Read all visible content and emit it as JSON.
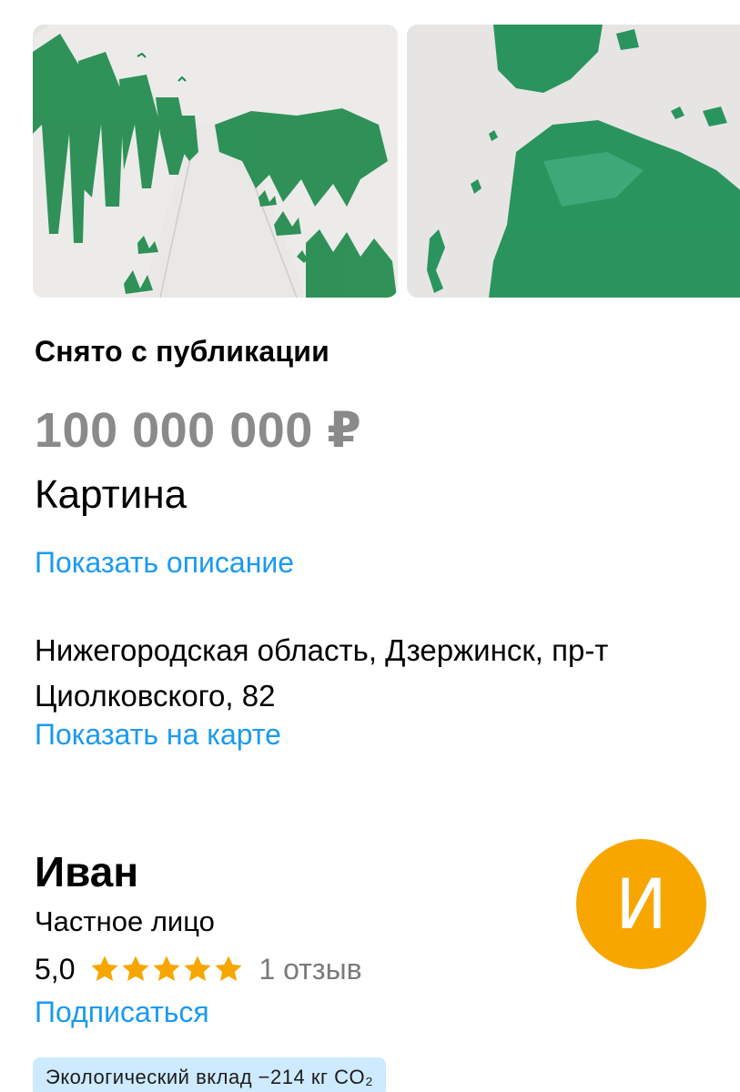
{
  "listing": {
    "status": "Снято с публикации",
    "price": "100 000 000 ₽",
    "title": "Картина",
    "show_description_link": "Показать описание",
    "address": "Нижегородская область, Дзержинск, пр-т Циолковского, 82",
    "show_on_map_link": "Показать на карте"
  },
  "seller": {
    "name": "Иван",
    "type": "Частное лицо",
    "rating": "5,0",
    "stars": 5,
    "reviews": "1 отзыв",
    "subscribe_link": "Подписаться",
    "avatar_letter": "И"
  },
  "eco_badge": "Экологический вклад −214 кг CO₂",
  "colors": {
    "link": "#1a9af0",
    "price": "#8a8a8a",
    "avatar": "#f7a600",
    "star": "#f7a600",
    "eco_badge_bg": "#cdeaff",
    "painting_green": "#1f8a4c"
  },
  "icons": {
    "rating_star": "star-icon"
  }
}
